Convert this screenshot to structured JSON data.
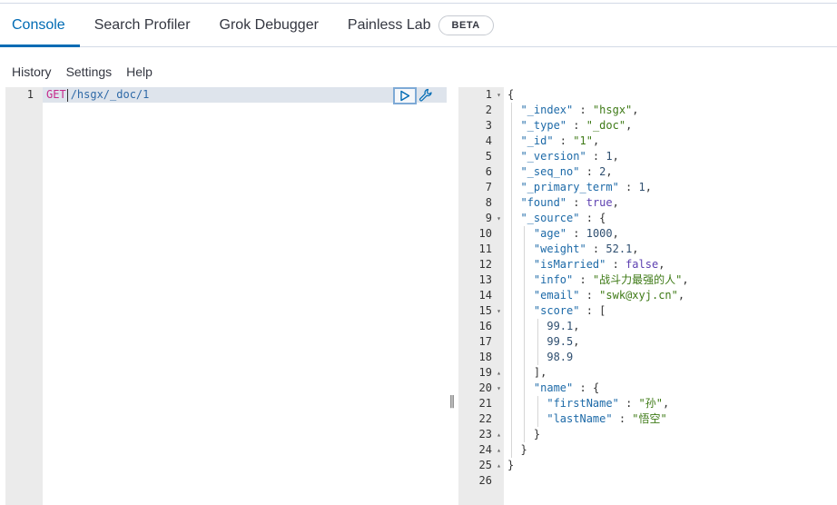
{
  "tabs": {
    "console": "Console",
    "search_profiler": "Search Profiler",
    "grok_debugger": "Grok Debugger",
    "painless_lab": "Painless Lab",
    "beta_badge": "BETA"
  },
  "menu": {
    "history": "History",
    "settings": "Settings",
    "help": "Help"
  },
  "request": {
    "line_number": "1",
    "method": "GET",
    "url": "/hsgx/_doc/1"
  },
  "response": {
    "lines": [
      {
        "num": "1",
        "fold": "▾",
        "text": "{"
      },
      {
        "num": "2",
        "fold": "",
        "text": "  \"_index\" : \"hsgx\","
      },
      {
        "num": "3",
        "fold": "",
        "text": "  \"_type\" : \"_doc\","
      },
      {
        "num": "4",
        "fold": "",
        "text": "  \"_id\" : \"1\","
      },
      {
        "num": "5",
        "fold": "",
        "text": "  \"_version\" : 1,"
      },
      {
        "num": "6",
        "fold": "",
        "text": "  \"_seq_no\" : 2,"
      },
      {
        "num": "7",
        "fold": "",
        "text": "  \"_primary_term\" : 1,"
      },
      {
        "num": "8",
        "fold": "",
        "text": "  \"found\" : true,"
      },
      {
        "num": "9",
        "fold": "▾",
        "text": "  \"_source\" : {"
      },
      {
        "num": "10",
        "fold": "",
        "text": "    \"age\" : 1000,"
      },
      {
        "num": "11",
        "fold": "",
        "text": "    \"weight\" : 52.1,"
      },
      {
        "num": "12",
        "fold": "",
        "text": "    \"isMarried\" : false,"
      },
      {
        "num": "13",
        "fold": "",
        "text": "    \"info\" : \"战斗力最强的人\","
      },
      {
        "num": "14",
        "fold": "",
        "text": "    \"email\" : \"swk@xyj.cn\","
      },
      {
        "num": "15",
        "fold": "▾",
        "text": "    \"score\" : ["
      },
      {
        "num": "16",
        "fold": "",
        "text": "      99.1,"
      },
      {
        "num": "17",
        "fold": "",
        "text": "      99.5,"
      },
      {
        "num": "18",
        "fold": "",
        "text": "      98.9"
      },
      {
        "num": "19",
        "fold": "▴",
        "text": "    ],"
      },
      {
        "num": "20",
        "fold": "▾",
        "text": "    \"name\" : {"
      },
      {
        "num": "21",
        "fold": "",
        "text": "      \"firstName\" : \"孙\","
      },
      {
        "num": "22",
        "fold": "",
        "text": "      \"lastName\" : \"悟空\""
      },
      {
        "num": "23",
        "fold": "▴",
        "text": "    }"
      },
      {
        "num": "24",
        "fold": "▴",
        "text": "  }"
      },
      {
        "num": "25",
        "fold": "▴",
        "text": "}"
      },
      {
        "num": "26",
        "fold": "",
        "text": ""
      }
    ]
  },
  "icons": {
    "run": "play-icon",
    "wrench": "wrench-icon",
    "resizer": "resize-handle-icon"
  },
  "colors": {
    "accent": "#006bb4",
    "gutter": "#ebebeb",
    "active_line": "#dee4ec",
    "method": "#c5288b",
    "string": "#3e7a16",
    "key": "#1d6aa8"
  }
}
